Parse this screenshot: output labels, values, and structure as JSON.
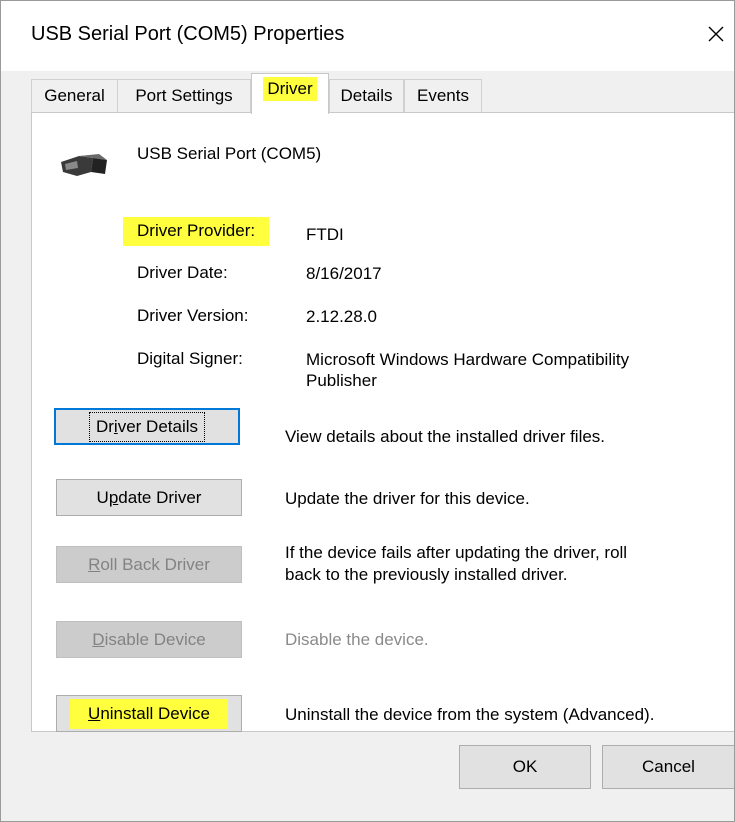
{
  "window": {
    "title": "USB Serial Port (COM5) Properties",
    "close_glyph": "✕"
  },
  "tabs": [
    {
      "label": "General"
    },
    {
      "label": "Port Settings"
    },
    {
      "label": "Driver"
    },
    {
      "label": "Details"
    },
    {
      "label": "Events"
    }
  ],
  "active_tab": "Driver",
  "device": {
    "name": "USB Serial Port (COM5)",
    "icon": "usb-connector-icon"
  },
  "properties": {
    "provider": {
      "label": "Driver Provider:",
      "value": "FTDI"
    },
    "date": {
      "label": "Driver Date:",
      "value": "8/16/2017"
    },
    "version": {
      "label": "Driver Version:",
      "value": "2.12.28.0"
    },
    "signer": {
      "label": "Digital Signer:",
      "value_line1": "Microsoft Windows Hardware Compatibility",
      "value_line2": "Publisher"
    }
  },
  "actions": {
    "driver_details": {
      "pre": "Dr",
      "key": "i",
      "post": "ver Details",
      "desc": "View details about the installed driver files."
    },
    "update_driver": {
      "pre": "U",
      "key": "p",
      "post": "date Driver",
      "desc": "Update the driver for this device."
    },
    "roll_back": {
      "pre": "",
      "key": "R",
      "post": "oll Back Driver",
      "desc_line1": "If the device fails after updating the driver, roll",
      "desc_line2": "back to the previously installed driver."
    },
    "disable": {
      "pre": "",
      "key": "D",
      "post": "isable Device",
      "desc": "Disable the device."
    },
    "uninstall": {
      "pre": "",
      "key": "U",
      "post": "ninstall Device",
      "desc": "Uninstall the device from the system (Advanced)."
    }
  },
  "footer": {
    "ok": "OK",
    "cancel": "Cancel"
  },
  "colors": {
    "highlight": "#ffff3d",
    "focus_border": "#0078d7",
    "disabled_text": "#838383"
  }
}
